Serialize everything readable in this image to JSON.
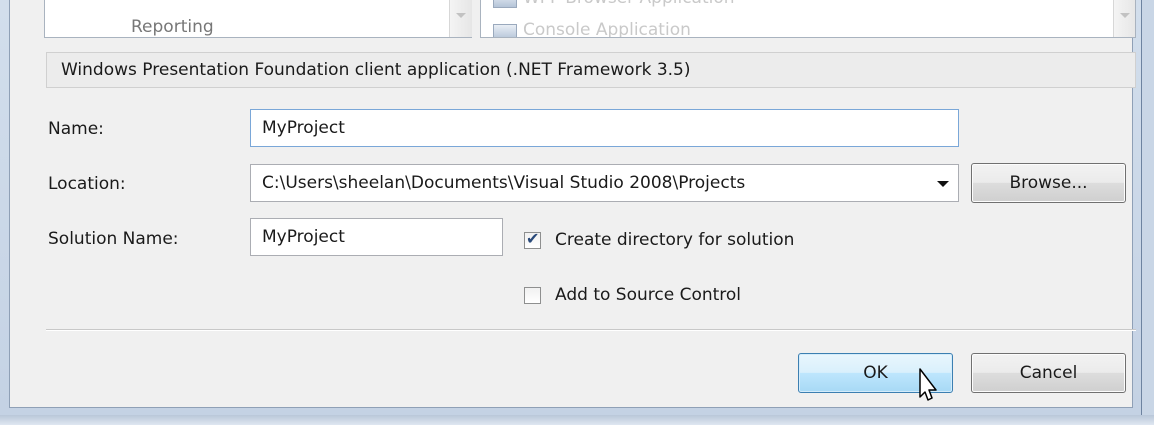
{
  "templates": {
    "left_item": "Reporting",
    "right_items": [
      "WPF Browser Application",
      "Console Application"
    ]
  },
  "description": "Windows Presentation Foundation client application (.NET Framework 3.5)",
  "form": {
    "name_label": "Name:",
    "name_value": "MyProject",
    "location_label": "Location:",
    "location_value": "C:\\Users\\sheelan\\Documents\\Visual Studio 2008\\Projects",
    "solution_label": "Solution Name:",
    "solution_value": "MyProject",
    "browse_label": "Browse...",
    "create_dir_label": "Create directory for solution",
    "create_dir_checked": true,
    "source_control_label": "Add to Source Control",
    "source_control_checked": false
  },
  "buttons": {
    "ok_label": "OK",
    "cancel_label": "Cancel"
  }
}
